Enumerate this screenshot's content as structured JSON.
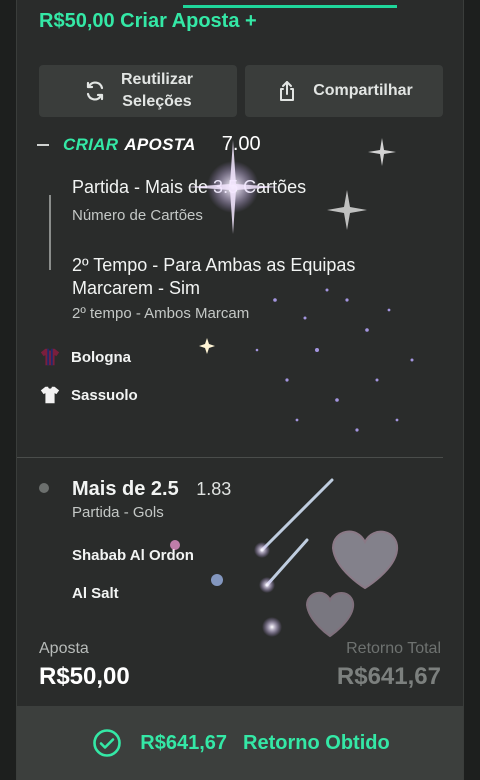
{
  "header": {
    "title": "R$50,00 Criar Aposta +"
  },
  "actions": {
    "reuse_label": "Reutilizar\nSeleções",
    "share_label": "Compartilhar"
  },
  "builder": {
    "brand_part1": "CRIAR",
    "brand_part2": "APOSTA",
    "odds": "7.00",
    "selections": [
      {
        "title": "Partida - Mais de 3.5 Cartões",
        "subtitle": "Número de Cartões"
      },
      {
        "title": "2º Tempo - Para Ambas as Equipas Marcarem - Sim",
        "subtitle": "2º tempo - Ambos Marcam"
      }
    ],
    "home_team": "Bologna",
    "away_team": "Sassuolo"
  },
  "single": {
    "title": "Mais de 2.5",
    "odds": "1.83",
    "subtitle": "Partida - Gols",
    "home_team": "Shabab Al Ordon",
    "away_team": "Al Salt"
  },
  "summary": {
    "stake_label": "Aposta",
    "stake_value": "R$50,00",
    "return_label": "Retorno Total",
    "return_value": "R$641,67"
  },
  "footer": {
    "amount": "R$641,67",
    "label": "Retorno Obtido"
  },
  "colors": {
    "accent": "#34e8a6",
    "background": "#1d1f1e",
    "card": "#2a2c2b"
  }
}
